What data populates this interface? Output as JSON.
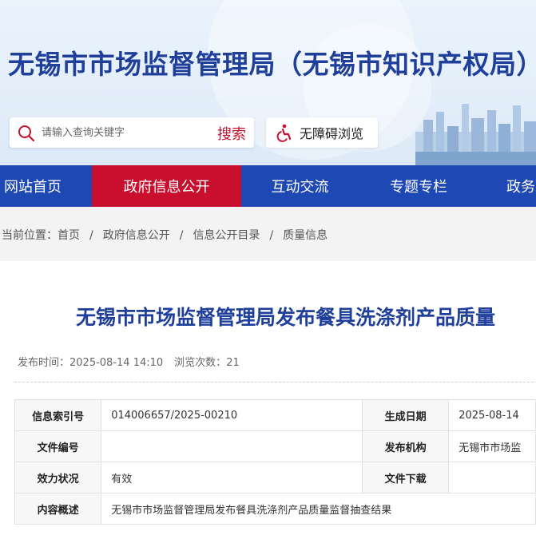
{
  "site": {
    "title": "无锡市市场监督管理局（无锡市知识产权局）"
  },
  "search": {
    "placeholder": "请输入查询关键字",
    "button_label": "搜索"
  },
  "accessibility": {
    "label": "无障碍浏览"
  },
  "nav": {
    "items": [
      {
        "label": "网站首页"
      },
      {
        "label": "政府信息公开"
      },
      {
        "label": "互动交流"
      },
      {
        "label": "专题专栏"
      },
      {
        "label": "政务"
      }
    ],
    "active_index": 1
  },
  "breadcrumb": {
    "prefix": "当前位置：",
    "items": [
      "首页",
      "政府信息公开",
      "信息公开目录",
      "质量信息"
    ],
    "separator": "/"
  },
  "article": {
    "title": "无锡市市场监督管理局发布餐具洗涤剂产品质量",
    "publish_label": "发布时间：",
    "publish_time": "2025-08-14 14:10",
    "views_label": "浏览次数：",
    "views": "21"
  },
  "info_table": {
    "rows": [
      {
        "label1": "信息索引号",
        "value1": "014006657/2025-00210",
        "label2": "生成日期",
        "value2": "2025-08-14"
      },
      {
        "label1": "文件编号",
        "value1": "",
        "label2": "发布机构",
        "value2": "无锡市市场监"
      },
      {
        "label1": "效力状况",
        "value1": "有效",
        "label2": "文件下载",
        "value2": ""
      },
      {
        "label1": "内容概述",
        "value1": "无锡市市场监督管理局发布餐具洗涤剂产品质量监督抽查结果"
      }
    ]
  },
  "colors": {
    "brand_blue": "#1e48b4",
    "title_blue": "#1f3f9a",
    "accent_red": "#c8102e"
  }
}
